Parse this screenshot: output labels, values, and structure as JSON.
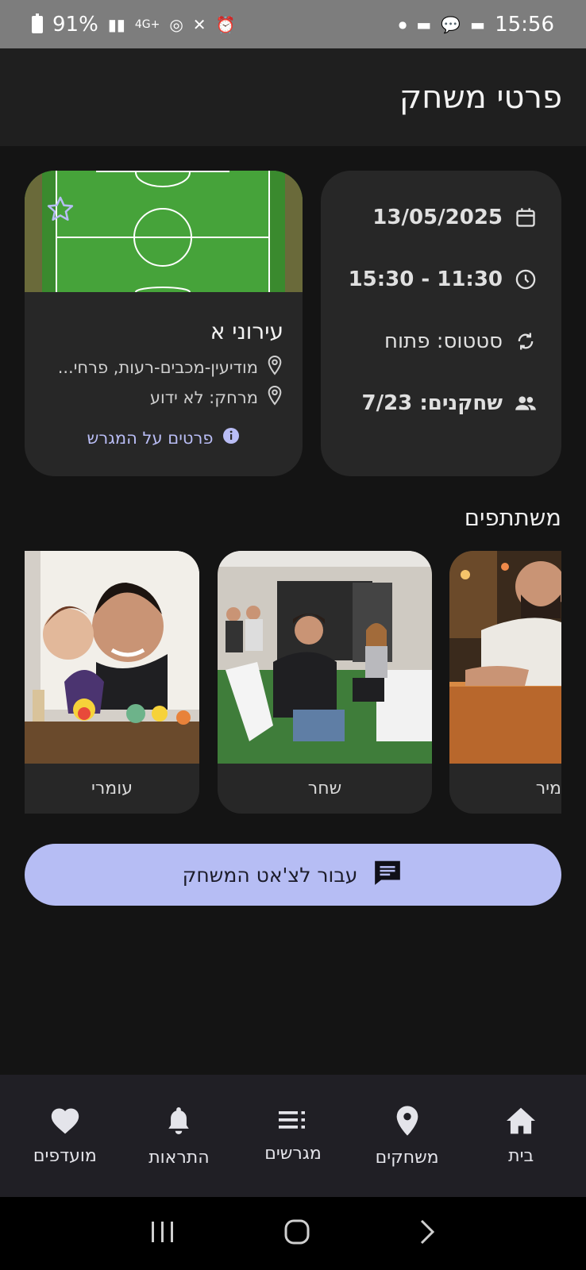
{
  "status_bar": {
    "battery": "91%",
    "time": "15:56",
    "network": "4G+"
  },
  "app_bar": {
    "title": "פרטי משחק"
  },
  "game": {
    "date": "13/05/2025",
    "time_range": "15:30 - 11:30",
    "status": "סטטוס: פתוח",
    "players": "שחקנים: 7/23"
  },
  "field": {
    "name": "עירוני א",
    "address": "מודיעין-מכבים-רעות, פרחי...",
    "distance": "מרחק: לא ידוע",
    "details_link": "פרטים על המגרש"
  },
  "participants": {
    "title": "משתתפים",
    "people": [
      {
        "name": "מיר"
      },
      {
        "name": "שחר"
      },
      {
        "name": "עומרי"
      }
    ]
  },
  "chat_button": {
    "label": "עבור לצ'אט המשחק"
  },
  "bottom_nav": {
    "items": [
      {
        "label": "בית",
        "icon": "home-icon"
      },
      {
        "label": "משחקים",
        "icon": "location-pin-icon"
      },
      {
        "label": "מגרשים",
        "icon": "list-icon"
      },
      {
        "label": "התראות",
        "icon": "bell-icon"
      },
      {
        "label": "מועדפים",
        "icon": "heart-icon"
      }
    ]
  },
  "colors": {
    "accent": "#b6bdf4",
    "card": "#272727",
    "background": "#141414"
  }
}
